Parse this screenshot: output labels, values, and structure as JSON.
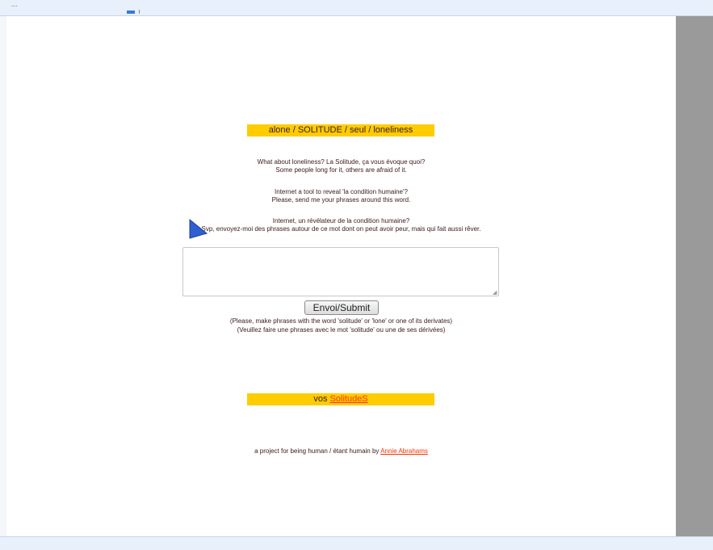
{
  "browser": {
    "top_text": "..."
  },
  "title_banner": "alone / SOLITUDE / seul / loneliness",
  "intro": {
    "p1_line1": "What about loneliness? La Solitude, ça vous évoque quoi?",
    "p1_line2": "Some people long for it, others are afraid of it.",
    "p2_line1": "Internet a tool to reveal 'la condition humaine'?",
    "p2_line2": "Please, send me your phrases around this word.",
    "p3_line1": "Internet, un révélateur de la condition humaine?",
    "p3_line2": "Svp, envoyez-moi des phrases autour de ce mot dont on peut avoir peur, mais qui fait aussi rêver."
  },
  "form": {
    "textarea_value": "",
    "submit_label": "Envoi/Submit",
    "note_en": "(Please, make phrases with the word 'solitude' or 'lone' or one of its derivates)",
    "note_fr": "(Veuillez faire une phrases avec le mot 'solitude' ou une de ses dérivées)"
  },
  "solitudes_banner": {
    "prefix": "vos",
    "link": "SolitudeS"
  },
  "credit": {
    "text": "a project for being human / étant humain by",
    "author_link": "Annie Abrahams"
  },
  "colors": {
    "banner_yellow": "#ffcc00",
    "link_red": "#ff3300",
    "scrollbar_gray": "#9a9a9a"
  }
}
